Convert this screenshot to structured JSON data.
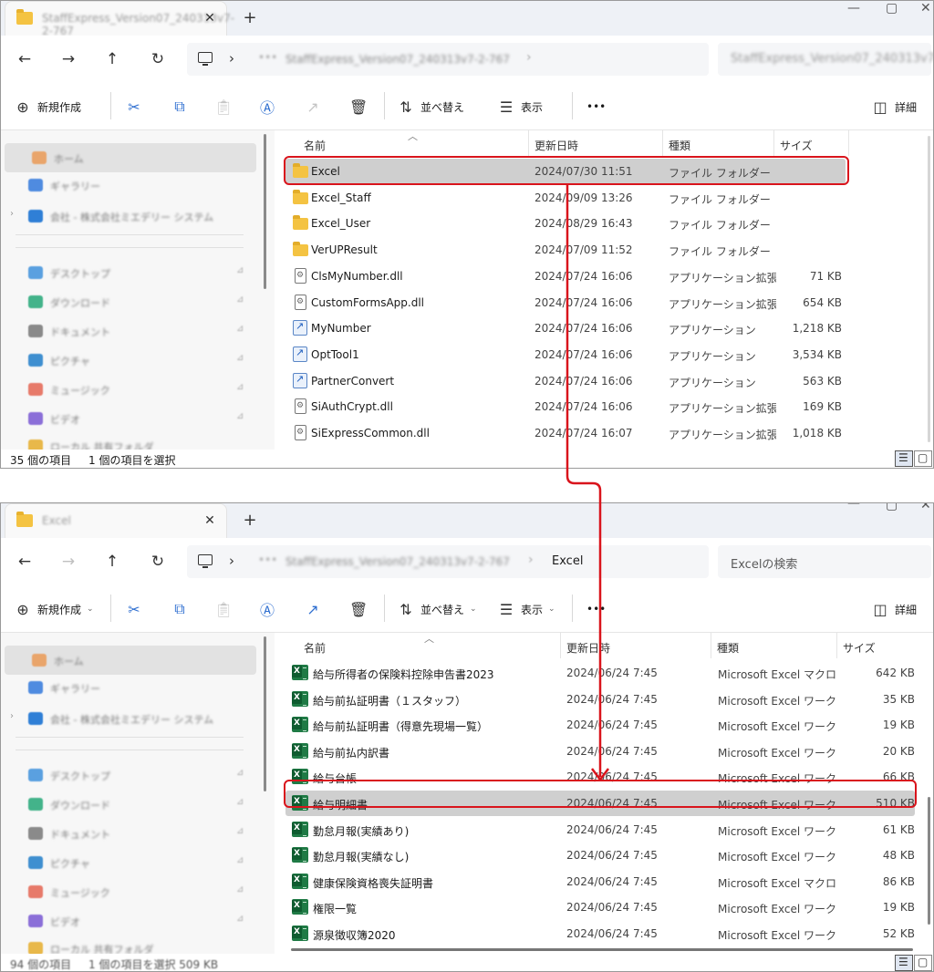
{
  "colors": {
    "highlight": "#d9141c",
    "accent": "#2f6fd0",
    "excel_green": "#1f7a45"
  },
  "win1": {
    "tab_title": "StaffExpress_Version07_240313v7-2-767",
    "address": {
      "path": "StaffExpress_Version07_240313v7-2-767",
      "search_placeholder": "StaffExpress_Version07_240313v7"
    },
    "toolbar": {
      "new": "新規作成",
      "sort": "並べ替え",
      "view": "表示",
      "more": "•••",
      "details": "詳細"
    },
    "nav": [
      {
        "label": "ホーム",
        "icon": "home-icon"
      },
      {
        "label": "ギャラリー",
        "icon": "gallery-icon"
      },
      {
        "label": "会社 - 株式会社ミエデリー システム",
        "icon": "cloud-icon"
      },
      {
        "label": "デスクトップ",
        "icon": "desktop-icon"
      },
      {
        "label": "ダウンロード",
        "icon": "download-icon"
      },
      {
        "label": "ドキュメント",
        "icon": "documents-icon"
      },
      {
        "label": "ピクチャ",
        "icon": "pictures-icon"
      },
      {
        "label": "ミュージック",
        "icon": "music-icon"
      },
      {
        "label": "ビデオ",
        "icon": "videos-icon"
      },
      {
        "label": "ローカル 共有フォルダ",
        "icon": "folder-icon"
      }
    ],
    "columns": {
      "name": "名前",
      "modified": "更新日時",
      "type": "種類",
      "size": "サイズ"
    },
    "rows": [
      {
        "name": "Excel",
        "modified": "2024/07/30 11:51",
        "type": "ファイル フォルダー",
        "size": "",
        "icon": "folder-icon"
      },
      {
        "name": "Excel_Staff",
        "modified": "2024/09/09 13:26",
        "type": "ファイル フォルダー",
        "size": "",
        "icon": "folder-icon"
      },
      {
        "name": "Excel_User",
        "modified": "2024/08/29 16:43",
        "type": "ファイル フォルダー",
        "size": "",
        "icon": "folder-icon"
      },
      {
        "name": "VerUPResult",
        "modified": "2024/07/09 11:52",
        "type": "ファイル フォルダー",
        "size": "",
        "icon": "folder-icon"
      },
      {
        "name": "ClsMyNumber.dll",
        "modified": "2024/07/24 16:06",
        "type": "アプリケーション拡張",
        "size": "71 KB",
        "icon": "dll-icon"
      },
      {
        "name": "CustomFormsApp.dll",
        "modified": "2024/07/24 16:06",
        "type": "アプリケーション拡張",
        "size": "654 KB",
        "icon": "dll-icon"
      },
      {
        "name": "MyNumber",
        "modified": "2024/07/24 16:06",
        "type": "アプリケーション",
        "size": "1,218 KB",
        "icon": "exe-icon"
      },
      {
        "name": "OptTool1",
        "modified": "2024/07/24 16:06",
        "type": "アプリケーション",
        "size": "3,534 KB",
        "icon": "exe-icon"
      },
      {
        "name": "PartnerConvert",
        "modified": "2024/07/24 16:06",
        "type": "アプリケーション",
        "size": "563 KB",
        "icon": "exe-icon"
      },
      {
        "name": "SiAuthCrypt.dll",
        "modified": "2024/07/24 16:06",
        "type": "アプリケーション拡張",
        "size": "169 KB",
        "icon": "dll-icon"
      },
      {
        "name": "SiExpressCommon.dll",
        "modified": "2024/07/24 16:07",
        "type": "アプリケーション拡張",
        "size": "1,018 KB",
        "icon": "dll-icon"
      }
    ],
    "status": {
      "count": "35 個の項目",
      "selected": "1 個の項目を選択"
    }
  },
  "win2": {
    "tab_title": "Excel",
    "address": {
      "path": "StaffExpress_Version07_240313v7-2-767",
      "current": "Excel",
      "search_placeholder": "Excelの検索"
    },
    "toolbar": {
      "new": "新規作成",
      "sort": "並べ替え",
      "view": "表示",
      "more": "•••",
      "details": "詳細"
    },
    "columns": {
      "name": "名前",
      "modified": "更新日時",
      "type": "種類",
      "size": "サイズ"
    },
    "rows": [
      {
        "name": "給与所得者の保険料控除申告書2023",
        "modified": "2024/06/24 7:45",
        "type": "Microsoft Excel マクロ...",
        "size": "642 KB"
      },
      {
        "name": "給与前払証明書（１スタッフ）",
        "modified": "2024/06/24 7:45",
        "type": "Microsoft Excel ワーク...",
        "size": "35 KB"
      },
      {
        "name": "給与前払証明書（得意先現場一覧）",
        "modified": "2024/06/24 7:45",
        "type": "Microsoft Excel ワーク...",
        "size": "19 KB"
      },
      {
        "name": "給与前払内訳書",
        "modified": "2024/06/24 7:45",
        "type": "Microsoft Excel ワーク...",
        "size": "20 KB"
      },
      {
        "name": "給与台帳",
        "modified": "2024/06/24 7:45",
        "type": "Microsoft Excel ワーク...",
        "size": "66 KB"
      },
      {
        "name": "給与明細書",
        "modified": "2024/06/24 7:45",
        "type": "Microsoft Excel ワーク...",
        "size": "510 KB"
      },
      {
        "name": "勤怠月報(実績あり)",
        "modified": "2024/06/24 7:45",
        "type": "Microsoft Excel ワーク...",
        "size": "61 KB"
      },
      {
        "name": "勤怠月報(実績なし)",
        "modified": "2024/06/24 7:45",
        "type": "Microsoft Excel ワーク...",
        "size": "48 KB"
      },
      {
        "name": "健康保険資格喪失証明書",
        "modified": "2024/06/24 7:45",
        "type": "Microsoft Excel マクロ...",
        "size": "86 KB"
      },
      {
        "name": "権限一覧",
        "modified": "2024/06/24 7:45",
        "type": "Microsoft Excel ワーク...",
        "size": "19 KB"
      },
      {
        "name": "源泉徴収簿2020",
        "modified": "2024/06/24 7:45",
        "type": "Microsoft Excel ワーク...",
        "size": "52 KB"
      }
    ],
    "status": {
      "count": "94 個の項目",
      "selected": "1 個の項目を選択 509 KB"
    }
  }
}
